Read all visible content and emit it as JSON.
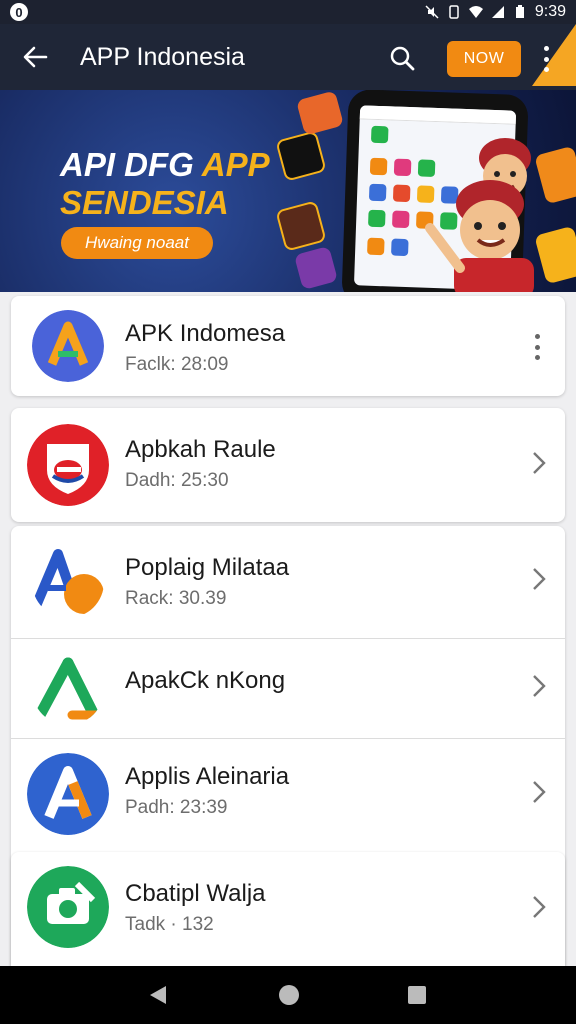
{
  "status_bar": {
    "badge": "0",
    "time": "9:39"
  },
  "app_bar": {
    "title": "APP Indonesia",
    "action_label": "NOW"
  },
  "banner": {
    "title_line1_a": "API DFG ",
    "title_line1_b": "APP",
    "title_line2": "SENDESIA",
    "pill_label": "Hwaing noaat"
  },
  "apps": [
    {
      "name": "APK Indomesa",
      "meta": "Faclk: 28:09",
      "icon": "letter-a-icon",
      "trailing": "overflow-menu"
    },
    {
      "name": "Apbkah Raule",
      "meta": "Dadh: 25:30",
      "icon": "shield-e-icon",
      "trailing": "chevron"
    },
    {
      "name": "Poplaig Milataa",
      "meta": "Rack: 30.39",
      "icon": "letter-a-orange-icon",
      "trailing": "chevron"
    },
    {
      "name": "ApakCk nKong",
      "meta": "",
      "icon": "letter-a-green-icon",
      "trailing": "chevron"
    },
    {
      "name": "Applis Aleinaria",
      "meta": "Padh: 23:39",
      "icon": "letter-a-blue-icon",
      "trailing": "chevron"
    },
    {
      "name": "Cbatipl Walja",
      "meta": "Tadk · 132",
      "icon": "camera-icon",
      "trailing": "chevron"
    }
  ],
  "colors": {
    "app_bar": "#1f2637",
    "accent": "#f18a12",
    "banner_yellow": "#f6b21b"
  }
}
